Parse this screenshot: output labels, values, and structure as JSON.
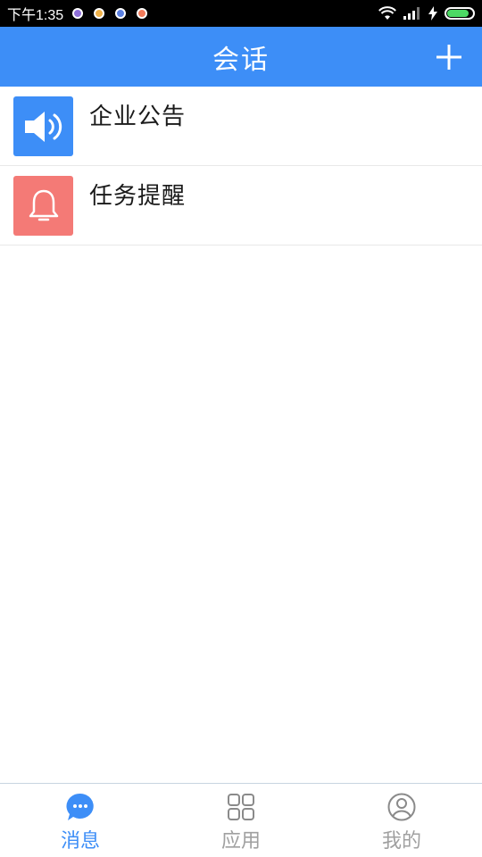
{
  "status_bar": {
    "time": "下午1:35",
    "notification_colors": [
      "#8e6fd8",
      "#f0b24a",
      "#5a7fe0",
      "#f07a5a"
    ]
  },
  "header": {
    "title": "会话",
    "add_icon": "plus-icon"
  },
  "conversations": [
    {
      "title": "企业公告",
      "icon": "speaker-icon",
      "color": "#3d8ef7"
    },
    {
      "title": "任务提醒",
      "icon": "bell-icon",
      "color": "#f47a76"
    }
  ],
  "tabs": [
    {
      "label": "消息",
      "icon": "chat-bubble-icon",
      "active": true
    },
    {
      "label": "应用",
      "icon": "grid-icon",
      "active": false
    },
    {
      "label": "我的",
      "icon": "user-icon",
      "active": false
    }
  ],
  "colors": {
    "accent": "#3d8ef7",
    "inactive": "#a0a0a0"
  }
}
